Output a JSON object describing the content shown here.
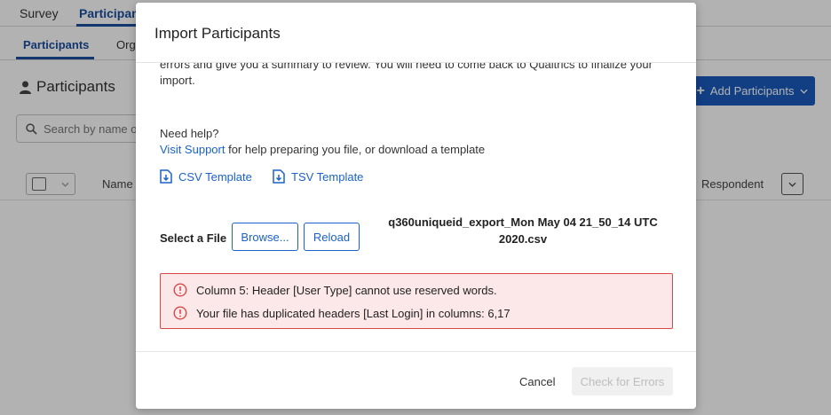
{
  "background": {
    "top_nav": {
      "survey": "Survey",
      "participants": "Participant"
    },
    "sub_nav": {
      "participants": "Participants",
      "org": "Org"
    },
    "page_title": "Participants",
    "add_button": "Add Participants",
    "search_placeholder": "Search by name o",
    "table": {
      "name_col": "Name",
      "respondent_col": "Respondent"
    }
  },
  "modal": {
    "title": "Import Participants",
    "intro_line1": "errors and give you a summary to review. You will need to come back to Qualtrics to finalize your",
    "intro_line2": "import.",
    "help_heading": "Need help?",
    "help_link": "Visit Support",
    "help_text": " for help preparing you file, or download a template",
    "csv_template": "CSV Template",
    "tsv_template": "TSV Template",
    "select_file_label": "Select a File",
    "browse_button": "Browse...",
    "reload_button": "Reload",
    "file_name_line1": "q360uniqueid_export_Mon May 04 21_50_14 UTC",
    "file_name_line2": "2020.csv",
    "errors": [
      "Column 5: Header [User Type] cannot use reserved words.",
      "Your file has duplicated headers [Last Login] in columns: 6,17"
    ],
    "cancel_button": "Cancel",
    "check_button": "Check for Errors"
  },
  "colors": {
    "accent": "#1a62c9",
    "error_border": "#d84848",
    "error_bg": "#fce8e8",
    "disabled_text": "#bdbdbd"
  }
}
